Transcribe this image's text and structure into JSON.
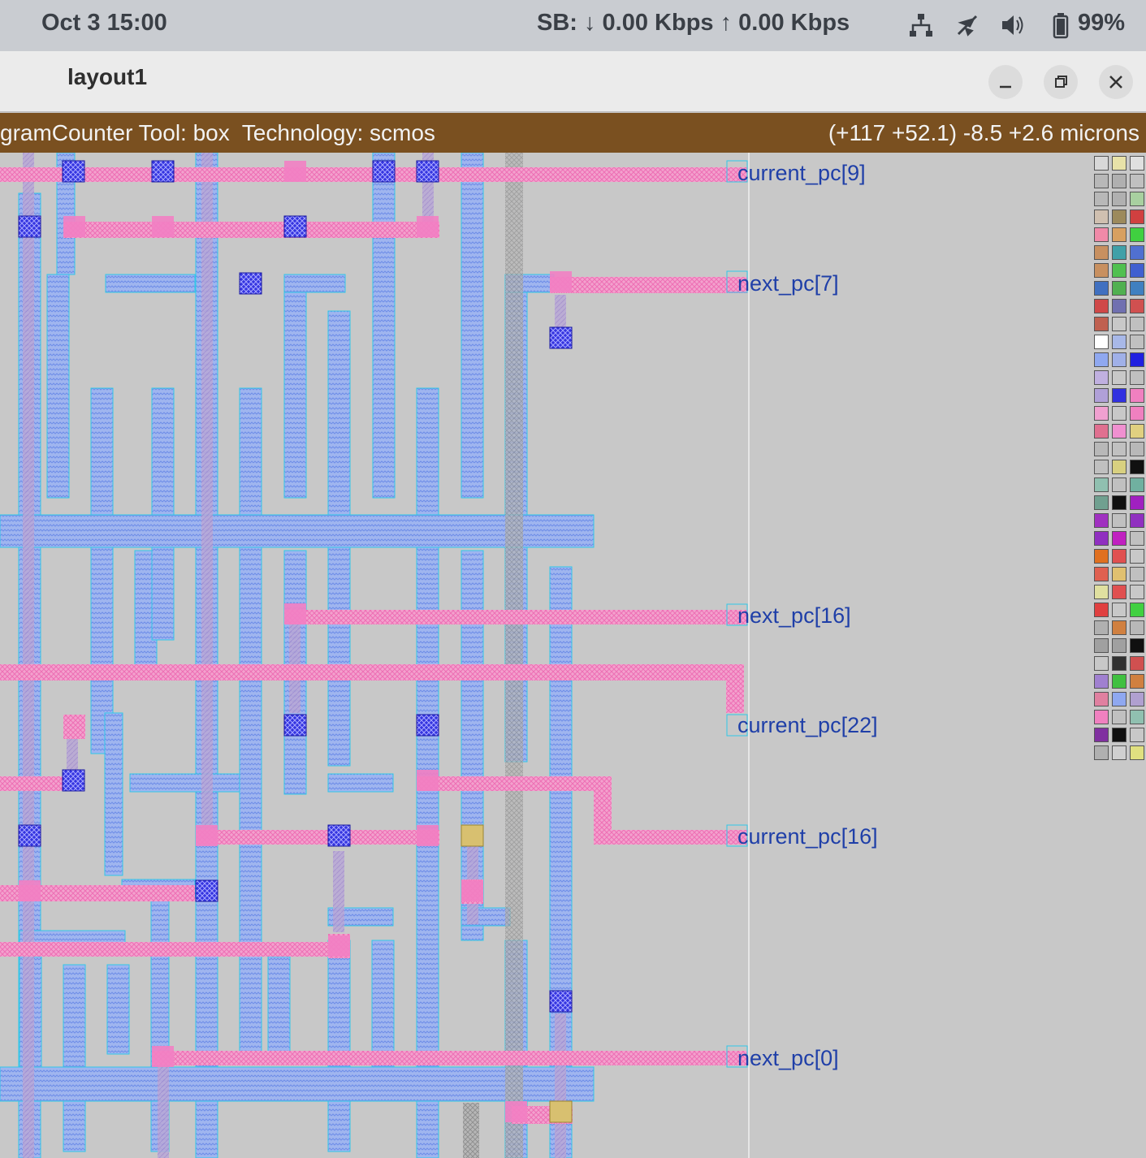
{
  "topbar": {
    "clock": "Oct 3  15:00",
    "network_speed": "SB: ↓ 0.00 Kbps  ↑ 0.00 Kbps",
    "battery": "99%",
    "icons": [
      "network-icon",
      "airplane-icon",
      "volume-icon",
      "battery-icon"
    ]
  },
  "window": {
    "title": "layout1",
    "buttons": [
      "minimize",
      "maximize",
      "close"
    ]
  },
  "status": {
    "left": "gramCounter Tool: box  Technology: scmos",
    "right": "(+117 +52.1) -8.5 +2.6 microns"
  },
  "labels": {
    "l1": "current_pc[9]",
    "l2": "next_pc[7]",
    "l3": "next_pc[16]",
    "l4": "current_pc[22]",
    "l5": "current_pc[16]",
    "l6": "next_pc[0]"
  },
  "colors": {
    "metal1": "#8fa8f0",
    "poly": "#f27fc3",
    "contact": "#2a2ad8",
    "background": "#c8c8c8",
    "status_bar": "#7a5020"
  }
}
